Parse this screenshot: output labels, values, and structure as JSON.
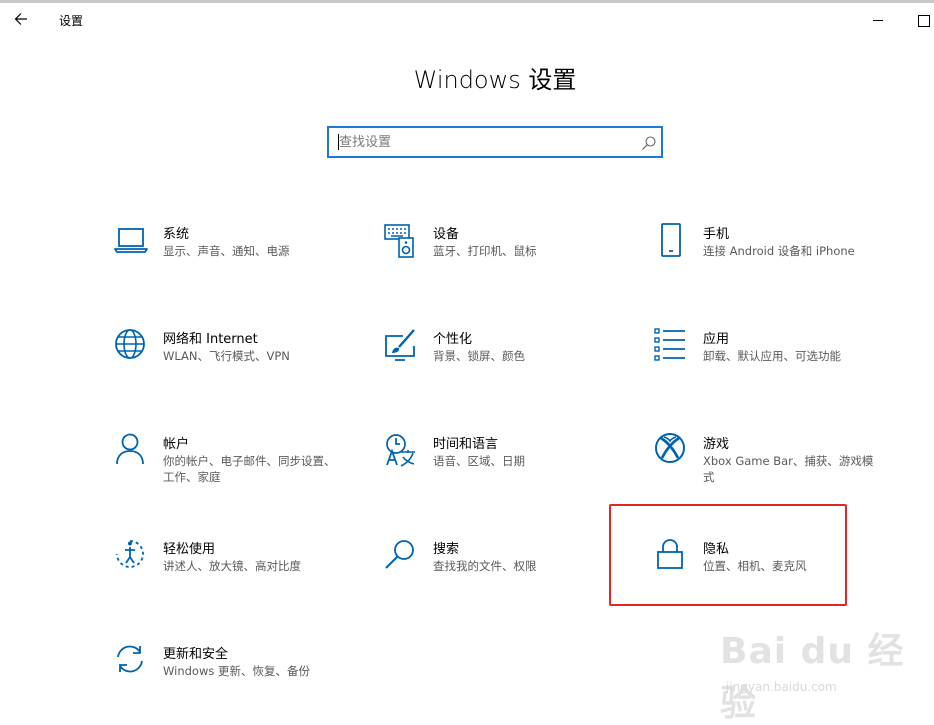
{
  "window": {
    "app_title": "设置",
    "back_icon": "back-arrow-icon",
    "minimize_icon": "minimize-icon",
    "maximize_icon": "maximize-icon"
  },
  "page": {
    "title": "Windows 设置"
  },
  "search": {
    "placeholder": "查找设置",
    "value": "",
    "icon": "search-icon"
  },
  "accent_color": "#0063b1",
  "highlight_color": "#e12626",
  "tiles": [
    {
      "title": "系统",
      "description": "显示、声音、通知、电源",
      "icon": "laptop-icon"
    },
    {
      "title": "设备",
      "description": "蓝牙、打印机、鼠标",
      "icon": "keyboard-icon"
    },
    {
      "title": "手机",
      "description": "连接 Android 设备和 iPhone",
      "icon": "phone-icon"
    },
    {
      "title": "网络和 Internet",
      "description": "WLAN、飞行模式、VPN",
      "icon": "globe-icon"
    },
    {
      "title": "个性化",
      "description": "背景、锁屏、颜色",
      "icon": "paint-icon"
    },
    {
      "title": "应用",
      "description": "卸载、默认应用、可选功能",
      "icon": "apps-list-icon"
    },
    {
      "title": "帐户",
      "description": "你的帐户、电子邮件、同步设置、工作、家庭",
      "icon": "person-icon"
    },
    {
      "title": "时间和语言",
      "description": "语音、区域、日期",
      "icon": "time-language-icon"
    },
    {
      "title": "游戏",
      "description": "Xbox Game Bar、捕获、游戏模式",
      "icon": "xbox-icon"
    },
    {
      "title": "轻松使用",
      "description": "讲述人、放大镜、高对比度",
      "icon": "ease-of-access-icon"
    },
    {
      "title": "搜索",
      "description": "查找我的文件、权限",
      "icon": "magnifier-icon"
    },
    {
      "title": "隐私",
      "description": "位置、相机、麦克风",
      "icon": "lock-icon"
    },
    {
      "title": "更新和安全",
      "description": "Windows 更新、恢复、备份",
      "icon": "sync-icon"
    }
  ],
  "watermark": {
    "logo": "Bai du 经验",
    "url": "jingyan.baidu.com"
  }
}
